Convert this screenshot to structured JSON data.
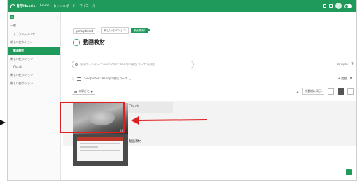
{
  "topbar": {
    "brand": "慧学Moodle",
    "nav_items": [
      "Home",
      "ダッシュボード",
      "マイコース"
    ]
  },
  "sidebar": {
    "collapse_label": "‹",
    "items": [
      {
        "label": "一般",
        "active": false,
        "indent": false
      },
      {
        "label": "アナウンスメント",
        "active": false,
        "indent": true
      },
      {
        "label": "新しいセクション",
        "active": false,
        "indent": false
      },
      {
        "label": "動画教材",
        "active": true,
        "indent": true
      },
      {
        "label": "新しいセクション",
        "active": false,
        "indent": false
      },
      {
        "label": "Clouds",
        "active": false,
        "indent": true
      },
      {
        "label": "新しいセクション",
        "active": false,
        "indent": false
      },
      {
        "label": "新しいセクション",
        "active": false,
        "indent": false
      }
    ]
  },
  "breadcrumb": {
    "items": [
      "panoptotest",
      "新しいセクション"
    ],
    "active": "動画教材"
  },
  "page": {
    "title": "動画教材"
  },
  "search": {
    "placeholder": "共有フォルダー \"panoptotest::Panopto検証コース\"を検索..."
  },
  "path": {
    "label": "panoptotest::Panopto検証コース"
  },
  "toolbar": {
    "date_label": "年頃ごと",
    "sort_label": "新着順に表示",
    "add_label": "+ 追加"
  },
  "items": [
    {
      "name": "Clouds",
      "duration": "0:14"
    },
    {
      "name": "動画教材",
      "duration": ""
    }
  ],
  "colors": {
    "accent": "#1f9a5a",
    "highlight": "#e02020"
  }
}
